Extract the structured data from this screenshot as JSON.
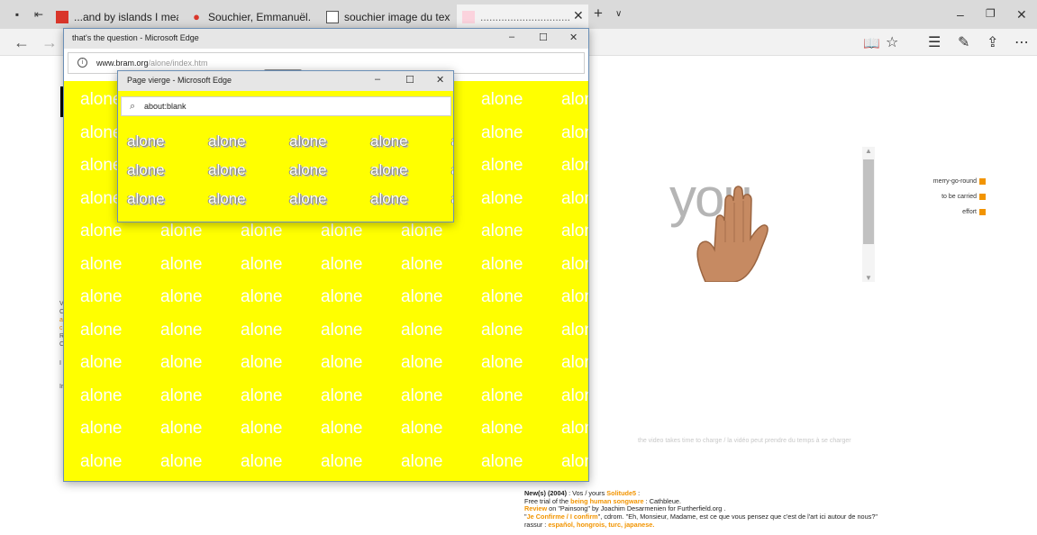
{
  "browser": {
    "tabs": [
      {
        "label": "...and by islands I mean para"
      },
      {
        "label": "Souchier, Emmanuël. 1998."
      },
      {
        "label": "souchier image du texte.pdf"
      },
      {
        "label": "......................................"
      }
    ]
  },
  "window1": {
    "title": "that's the question - Microsoft Edge",
    "url_host": "www.bram.org",
    "url_path": "/alone/index.htm",
    "word": "alone"
  },
  "window2": {
    "title": "Page vierge - Microsoft Edge",
    "url": "about:blank",
    "word": "alone"
  },
  "page": {
    "you_word": "you",
    "menu": [
      {
        "label": "merry-go-round"
      },
      {
        "label": "to be carried"
      },
      {
        "label": "effort"
      }
    ],
    "video_note": "the video takes time to charge / la vidéo peut prendre du temps à se charger",
    "left_fragments": [
      "V",
      "C",
      "a",
      "c",
      "R",
      "C",
      "I",
      "Ir"
    ],
    "news": {
      "l1_bold": "New(s) (2004)",
      "l1_mid": " : Vos / yours ",
      "l1_link": "Solitude5",
      "l1_end": " :",
      "l2_a": "Free trial of the ",
      "l2_link": "being human songware",
      "l2_b": " : Cathbleue.",
      "l3_link": "Review",
      "l3_b": " on \"Painsong\" by Joachim Desarmenien for Furtherfield.org .",
      "l4_q1": "\"",
      "l4_link": "Je Confirme / I confirm",
      "l4_b": "\", cdrom. \"Eh, Monsieur, Madame, est ce que vous pensez que c'est de l'art ici autour de nous?\"",
      "l5_a": "rassur : ",
      "l5_link": "español, hongrois, turc, japanese."
    }
  }
}
